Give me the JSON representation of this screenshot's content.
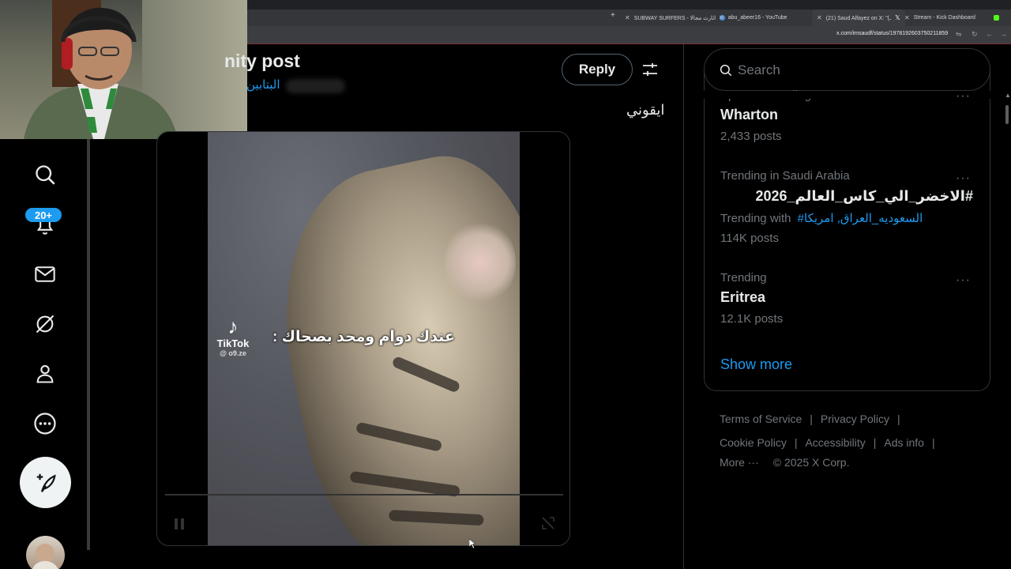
{
  "browser": {
    "tabs": [
      {
        "label": "SUBWAY SURFERS - اثارث مجالا",
        "color": "#e8eaed"
      },
      {
        "label": "abu_abeer16 - YouTube",
        "color": "#ff0000"
      },
      {
        "label": "(21) Saud Alfayez on X: \"(ـ",
        "color": "#ffffff"
      },
      {
        "label": "Stream - Kick Dashboard",
        "color": "#53fc18"
      }
    ],
    "url": "x.com/imsaudf/status/1978192603750211859"
  },
  "nav": {
    "notifications_badge": "20+"
  },
  "post": {
    "title_fragment": "nity post",
    "subtitle_fragment": "البتابين",
    "reply_label": "Reply",
    "text": "ايقوني",
    "video": {
      "watermark_logo": "♪",
      "watermark_name": "TikTok",
      "watermark_handle": "@ o9.ze",
      "caption": "عندك دوام ومحد بصحاك :"
    }
  },
  "sidebar": {
    "search_placeholder": "Search",
    "trends": [
      {
        "category": "Sports · Trending",
        "name": "Wharton",
        "count": "2,433 posts"
      },
      {
        "category": "Trending in Saudi Arabia",
        "name": "#الاخضر_الي_كاس_العالم_2026",
        "trending_with_label": "Trending with",
        "trending_with_links": "#السعوديه_العراق, امريكا",
        "count": "114K posts"
      },
      {
        "category": "Trending",
        "name": "Eritrea",
        "count": "12.1K posts"
      }
    ],
    "show_more": "Show more",
    "footer": {
      "terms": "Terms of Service",
      "privacy": "Privacy Policy",
      "cookie": "Cookie Policy",
      "accessibility": "Accessibility",
      "ads": "Ads info",
      "more": "More ···",
      "copyright": "© 2025 X Corp."
    }
  }
}
